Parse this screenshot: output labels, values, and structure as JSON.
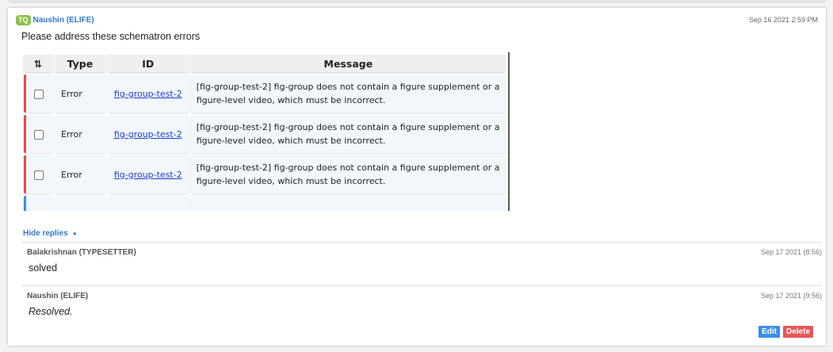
{
  "comment": {
    "initials": "TQ",
    "author": "Naushin (ELIFE)",
    "date": "Sep 16 2021 2:59 PM",
    "message": "Please address these schematron errors"
  },
  "table": {
    "headers": {
      "sort": "⇅",
      "type": "Type",
      "id": "ID",
      "message": "Message"
    },
    "rows": [
      {
        "type": "Error",
        "id": "fig-group-test-2",
        "message": "[fig-group-test-2] fig-group does not contain a figure supplement or a figure-level video, which must be incorrect."
      },
      {
        "type": "Error",
        "id": "fig-group-test-2",
        "message": "[fig-group-test-2] fig-group does not contain a figure supplement or a figure-level video, which must be incorrect."
      },
      {
        "type": "Error",
        "id": "fig-group-test-2",
        "message": "[fig-group-test-2] fig-group does not contain a figure supplement or a figure-level video, which must be incorrect."
      }
    ]
  },
  "replies_toggle": "Hide replies",
  "replies": [
    {
      "author": "Balakrishnan (TYPESETTER)",
      "date": "Sep 17 2021 (8:56)",
      "text": "solved"
    },
    {
      "author": "Naushin (ELIFE)",
      "date": "Sep 17 2021 (9:56)",
      "text": "Resolved."
    }
  ],
  "actions": {
    "edit": "Edit",
    "delete": "Delete"
  },
  "colors": {
    "accent": "#2f79c7",
    "error_marker": "#e14b4b",
    "edit": "#3a8ee6",
    "delete": "#e85555",
    "initials_bg": "#8bc34a"
  }
}
